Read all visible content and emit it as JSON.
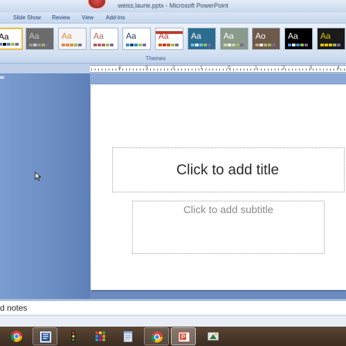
{
  "window": {
    "title": "weiss,laurie.pptx - Microsoft PowerPoint"
  },
  "ribbon_tabs": [
    {
      "label": "Slide Show"
    },
    {
      "label": "Review"
    },
    {
      "label": "View"
    },
    {
      "label": "Add-Ins"
    }
  ],
  "themes_group": {
    "label": "Themes",
    "items": [
      {
        "name": "Office Theme",
        "sample": "Aa",
        "bg": "#ffffff",
        "fg": "#000000",
        "accent": "#4f81bd",
        "selected": true
      },
      {
        "name": "Gray Theme",
        "sample": "Aa",
        "bg": "#6b6b6b",
        "fg": "#c8c8c8",
        "accent": "#9a9a9a"
      },
      {
        "name": "Orange Theme",
        "sample": "Aa",
        "bg": "#f4f4f4",
        "fg": "#e2873b",
        "accent": "#e2873b"
      },
      {
        "name": "Light Theme",
        "sample": "Aa",
        "bg": "#ffffff",
        "fg": "#b06060",
        "accent": "#b06060"
      },
      {
        "name": "Blue Text Theme",
        "sample": "Aa",
        "bg": "#ffffff",
        "fg": "#1f3b63",
        "accent": "#2a8fbf"
      },
      {
        "name": "Red Band Theme",
        "sample": "Aa",
        "bg": "#ffffff",
        "fg": "#c0392b",
        "accent": "#d35400",
        "band": "#c0392b"
      },
      {
        "name": "Teal Theme",
        "sample": "Aa",
        "bg": "#2b6c8f",
        "fg": "#ffffff",
        "accent": "#6ec1e4"
      },
      {
        "name": "Gray Green Theme",
        "sample": "Aa",
        "bg": "#8a9a8a",
        "fg": "#ffffff",
        "accent": "#d4d4aa"
      },
      {
        "name": "Brown Theme",
        "sample": "Ao",
        "bg": "#6e5a4a",
        "fg": "#ffffff",
        "accent": "#c9a77a"
      },
      {
        "name": "Black Theme",
        "sample": "Aa",
        "bg": "#000000",
        "fg": "#ffffff",
        "accent": "#4a90d9"
      },
      {
        "name": "Dark Gold Theme",
        "sample": "Aa",
        "bg": "#1a1a1a",
        "fg": "#e8c500",
        "accent": "#e8c500"
      }
    ]
  },
  "ruler": {
    "numbers": [
      "4",
      "3",
      "2",
      "1",
      "0",
      "1",
      "2",
      "3",
      "4"
    ]
  },
  "slide": {
    "title_placeholder": "Click to add title",
    "subtitle_placeholder": "Click to add subtitle"
  },
  "notes": {
    "placeholder": "d notes"
  },
  "taskbar": {
    "items": [
      {
        "icon": "chrome-icon",
        "state": "plain"
      },
      {
        "icon": "word-icon",
        "state": "pinned"
      },
      {
        "icon": "media-player-icon",
        "state": "plain"
      },
      {
        "icon": "apps-grid-icon",
        "state": "plain"
      },
      {
        "icon": "notepad-icon",
        "state": "plain"
      },
      {
        "icon": "chrome-icon",
        "state": "pinned"
      },
      {
        "icon": "powerpoint-icon",
        "state": "active"
      },
      {
        "icon": "recorder-icon",
        "state": "plain"
      }
    ]
  },
  "colors": {
    "ribbon_blue": "#d4e1f2",
    "workspace_blue": "#6c8cc0",
    "taskbar_brown": "#3b2c22",
    "selected_theme_border": "#f0b73c"
  }
}
